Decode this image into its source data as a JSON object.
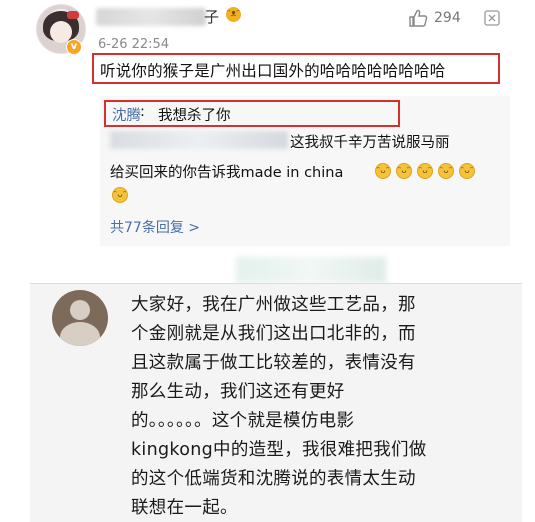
{
  "top_comment": {
    "username_suffix": "子",
    "username_emoji": "ᵔᴥᵔ",
    "verified_mark": "v",
    "likes": "294",
    "date": "6-26 22:54",
    "text": "听说你的猴子是广州出口国外的哈哈哈哈哈哈哈哈",
    "icons": {
      "like": "thumbs-up-icon",
      "more": "more-box-icon"
    },
    "highlight_color": "#d62f2f"
  },
  "replies": [
    {
      "name": "沈腾",
      "separator": ": ",
      "text": "我想杀了你"
    },
    {
      "text_line1": "这我叔千辛万苦说服马丽",
      "text_line2": "给买回来的你告诉我made in china"
    }
  ],
  "laugh_emoji": "ᵔᴗᵔ",
  "replies_link": "共77条回复 >",
  "reply_comment": {
    "lines": [
      "大家好，我在广州做这些工艺品，那",
      "个金刚就是从我们这出口北非的，而",
      "且这款属于做工比较差的，表情没有",
      "那么生动，我们这还有更好",
      "的。。。。。。这个就是模仿电影",
      "kingkong中的造型，我很难把我们做",
      "的这个低端货和沈腾说的表情太生动",
      "联想在一起。"
    ]
  },
  "colors": {
    "link": "#4a6fa5",
    "accent": "#f5a623"
  }
}
